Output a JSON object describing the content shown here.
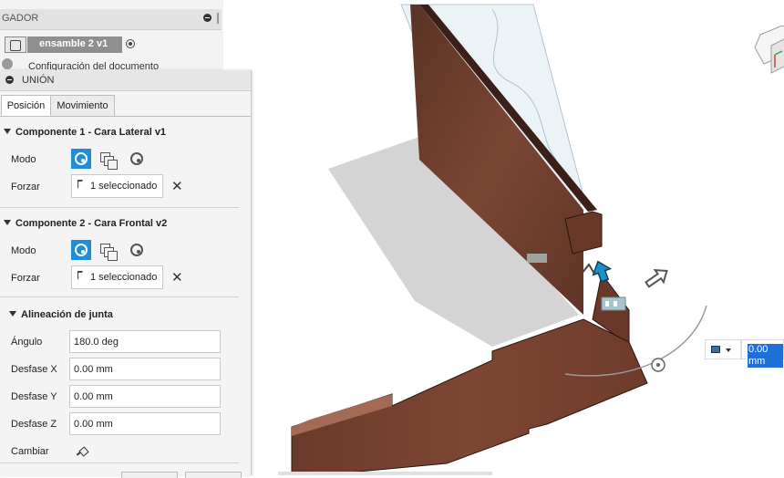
{
  "browser": {
    "title": "GADOR",
    "assembly_name": "ensamble 2 v1",
    "doc_settings": "Configuración del documento"
  },
  "joint_dialog": {
    "title": "UNIÓN",
    "tabs": [
      {
        "label": "Posición",
        "active": true
      },
      {
        "label": "Movimiento",
        "active": false
      }
    ],
    "component1": {
      "header": "Componente 1 - Cara Lateral v1",
      "mode_label": "Modo",
      "snap_label": "Forzar",
      "selection": "1 seleccionado"
    },
    "component2": {
      "header": "Componente 2 - Cara Frontal v2",
      "mode_label": "Modo",
      "snap_label": "Forzar",
      "selection": "1 seleccionado"
    },
    "alignment": {
      "header": "Alineación de junta",
      "angle_label": "Ángulo",
      "angle_value": "180.0 deg",
      "offset_x_label": "Desfase X",
      "offset_x_value": "0.00 mm",
      "offset_y_label": "Desfase Y",
      "offset_y_value": "0.00 mm",
      "offset_z_label": "Desfase Z",
      "offset_z_value": "0.00 mm",
      "flip_label": "Cambiar"
    }
  },
  "viewport": {
    "dimension_value": "0.00 mm"
  },
  "colors": {
    "accent": "#1e8ed8",
    "wood": "#6b3a2a",
    "shadow": "#d0d0d0"
  }
}
